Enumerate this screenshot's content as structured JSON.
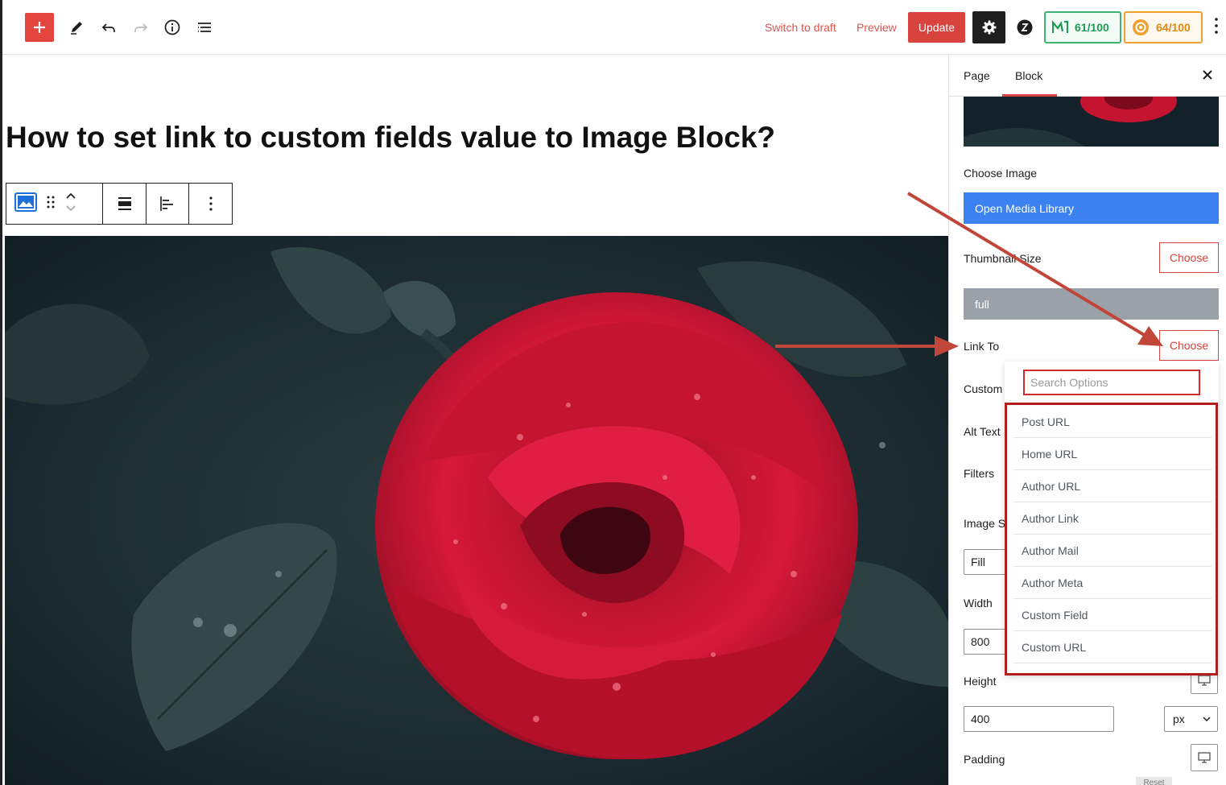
{
  "topbar": {
    "switch_draft": "Switch to draft",
    "preview": "Preview",
    "update": "Update",
    "score_a": "61/100",
    "score_b": "64/100"
  },
  "post": {
    "title": "How to set link to custom fields value to Image Block?"
  },
  "sidebar": {
    "tab_page": "Page",
    "tab_block": "Block",
    "choose_image_label": "Choose Image",
    "open_media": "Open Media Library",
    "thumbnail_size_label": "Thumbnail Size",
    "choose_label": "Choose",
    "thumbnail_size_value": "full",
    "link_to_label": "Link To",
    "custom_label": "Custom",
    "alt_text_label": "Alt Text",
    "filters_label": "Filters",
    "image_s_label": "Image S",
    "fill_value": "Fill",
    "width_label": "Width",
    "width_value": "800",
    "height_label": "Height",
    "height_value": "400",
    "unit_value": "px",
    "padding_label": "Padding",
    "reset_label": "Reset"
  },
  "dropdown": {
    "search_placeholder": "Search Options",
    "items": [
      "Post URL",
      "Home URL",
      "Author URL",
      "Author Link",
      "Author Mail",
      "Author Meta",
      "Custom Field",
      "Custom URL"
    ]
  },
  "colors": {
    "accent": "#d9433d",
    "blue": "#3b82f0",
    "annotation": "#c0463a"
  }
}
